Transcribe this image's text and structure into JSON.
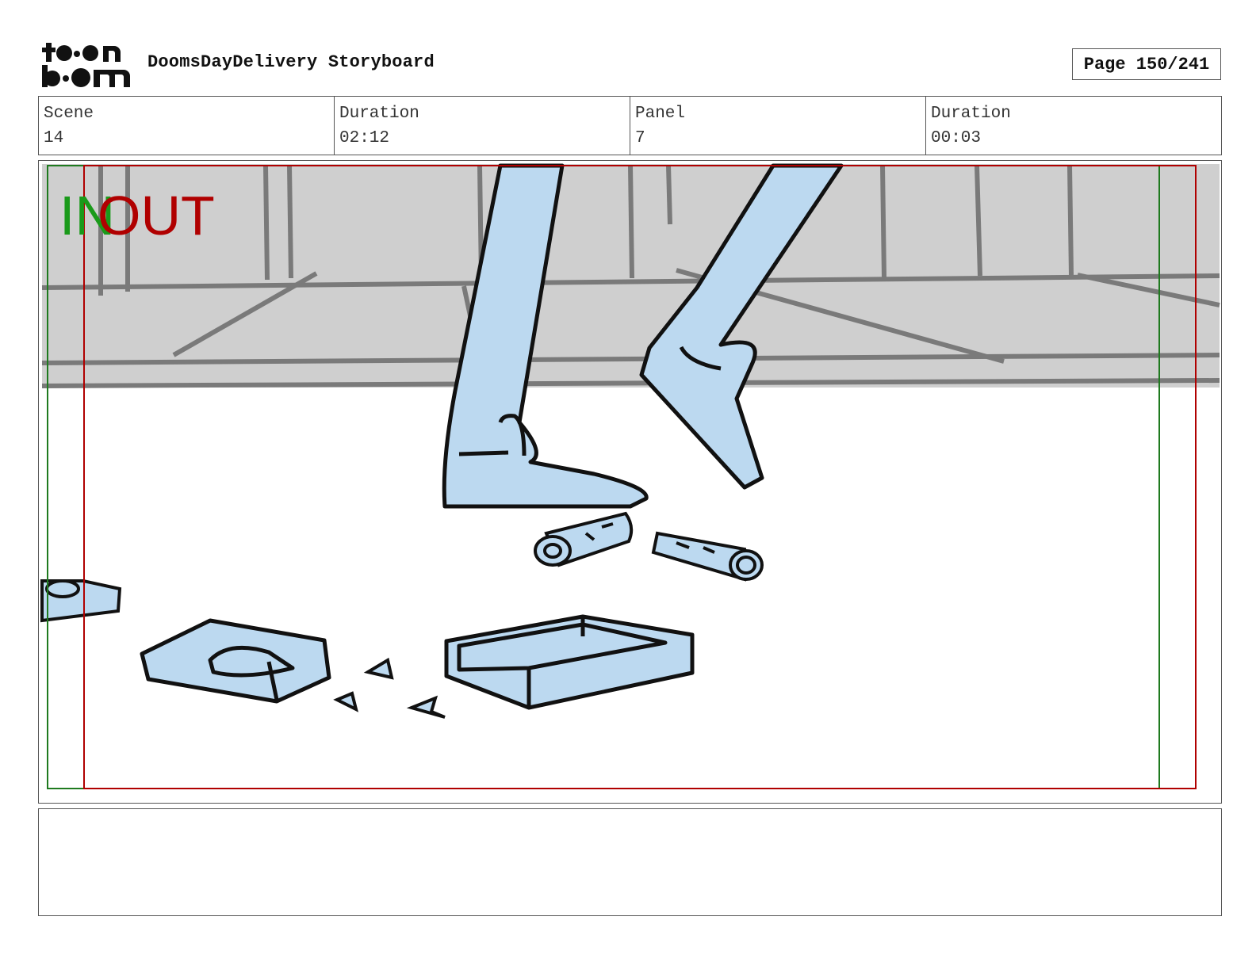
{
  "header": {
    "logo_text_top": "toon",
    "logo_text_bottom": "boom",
    "title": "DoomsDayDelivery Storyboard",
    "page_label": "Page 150/241"
  },
  "info": {
    "scene_label": "Scene",
    "scene_value": "14",
    "scene_duration_label": "Duration",
    "scene_duration_value": "02:12",
    "panel_label": "Panel",
    "panel_value": "7",
    "panel_duration_label": "Duration",
    "panel_duration_value": "00:03"
  },
  "panel": {
    "in_marker": "IN",
    "out_marker": "OUT",
    "description": "",
    "colors": {
      "in_marker": "#1a9a1a",
      "out_marker": "#b00000",
      "skin": "#bcd9f0",
      "wall": "#cfcfcf"
    }
  },
  "notes": {
    "text": ""
  }
}
